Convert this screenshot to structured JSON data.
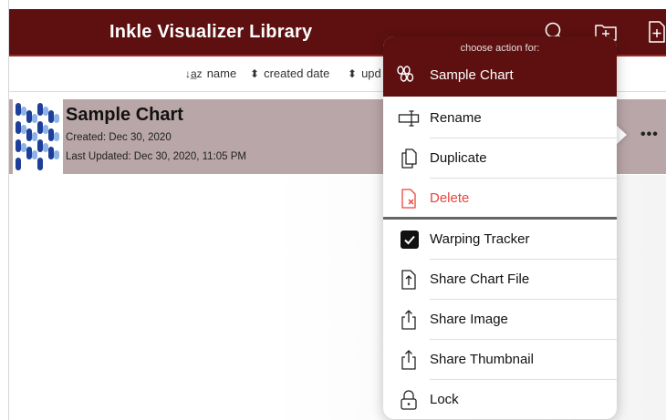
{
  "header": {
    "title": "Inkle Visualizer Library",
    "background": "#5e1010",
    "icons": [
      "search-icon",
      "new-folder-icon",
      "new-file-icon"
    ]
  },
  "sortbar": {
    "name_label": "name",
    "created_label": "created date",
    "updated_label": "upd",
    "name_icon": "↓a̲z",
    "sort_icon": "⬍"
  },
  "row": {
    "title": "Sample Chart",
    "created": "Created: Dec 30, 2020",
    "updated": "Last Updated: Dec 30, 2020, 11:05 PM",
    "more": "•••",
    "background": "#b9a6a8"
  },
  "popover": {
    "subtitle": "choose action for:",
    "title": "Sample Chart",
    "items": [
      {
        "label": "Rename",
        "icon": "rename-icon"
      },
      {
        "label": "Duplicate",
        "icon": "duplicate-icon"
      },
      {
        "label": "Delete",
        "icon": "delete-icon",
        "color": "#e8453b"
      },
      {
        "label": "Warping Tracker",
        "icon": "checkbox-icon",
        "checked": true
      },
      {
        "label": "Share Chart File",
        "icon": "share-file-icon"
      },
      {
        "label": "Share Image",
        "icon": "share-icon"
      },
      {
        "label": "Share Thumbnail",
        "icon": "share-icon"
      },
      {
        "label": "Lock",
        "icon": "lock-icon"
      }
    ]
  }
}
